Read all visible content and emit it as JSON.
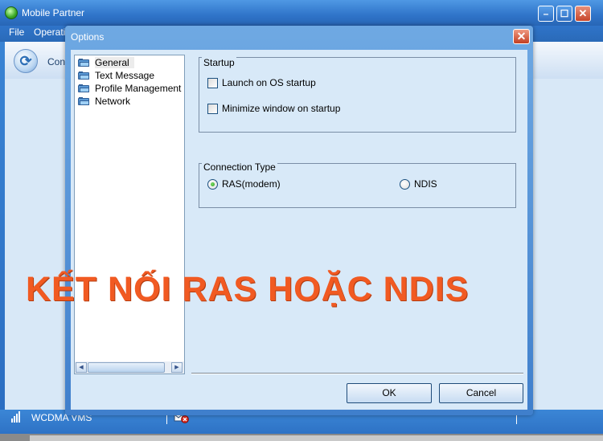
{
  "main_window": {
    "title": "Mobile Partner",
    "menu": {
      "file": "File",
      "operation": "Operati"
    },
    "toolbar": {
      "connect_label": "Con"
    },
    "status": {
      "network": "WCDMA  VMS"
    }
  },
  "dialog": {
    "title": "Options",
    "tree": {
      "items": [
        "General",
        "Text Message",
        "Profile Management",
        "Network"
      ],
      "selected": "General"
    },
    "startup": {
      "title": "Startup",
      "launch_label": "Launch on OS startup",
      "launch_checked": false,
      "minimize_label": "Minimize window on startup",
      "minimize_checked": false
    },
    "connection_type": {
      "title": "Connection Type",
      "ras_label": "RAS(modem)",
      "ndis_label": "NDIS",
      "selected": "RAS(modem)"
    },
    "buttons": {
      "ok": "OK",
      "cancel": "Cancel"
    }
  },
  "overlay": {
    "caption": "KẾT NỐI RAS HOẶC NDIS",
    "color": "#f15a22"
  },
  "icons": {
    "app": "app-icon",
    "connect": "connect-icon",
    "folder": "folder-icon",
    "signal": "signal-icon",
    "sms": "sms-icon"
  }
}
